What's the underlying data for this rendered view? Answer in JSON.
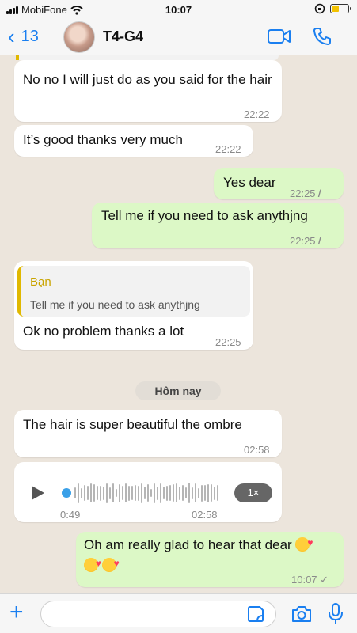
{
  "status": {
    "carrier": "MobiFone",
    "time": "10:07"
  },
  "header": {
    "back_count": "13",
    "title": "T4-G4"
  },
  "messages": [
    {
      "text": "No no I will just do as you said for the hair",
      "time": "22:22"
    },
    {
      "text": "It’s good thanks very much",
      "time": "22:22"
    },
    {
      "text": "Yes dear",
      "time": "22:25"
    },
    {
      "text": "Tell me if you need to ask anythjng",
      "time": "22:25"
    },
    {
      "reply_name": "Bạn",
      "reply_text": "Tell me if you need to ask anythjng",
      "text": "Ok no problem thanks a lot",
      "time": "22:25"
    },
    {
      "text": "The hair is super beautiful the ombre",
      "time": "02:58"
    },
    {
      "voice_elapsed": "0:49",
      "voice_total": "02:58",
      "speed": "1×"
    },
    {
      "text": "Oh am really glad to hear that dear",
      "time": "10:07"
    }
  ],
  "date_divider": "Hôm nay",
  "colors": {
    "accent": "#1a7ff0",
    "incoming": "#ffffff",
    "outgoing": "#dcf8c6",
    "quote": "#e0b800"
  }
}
